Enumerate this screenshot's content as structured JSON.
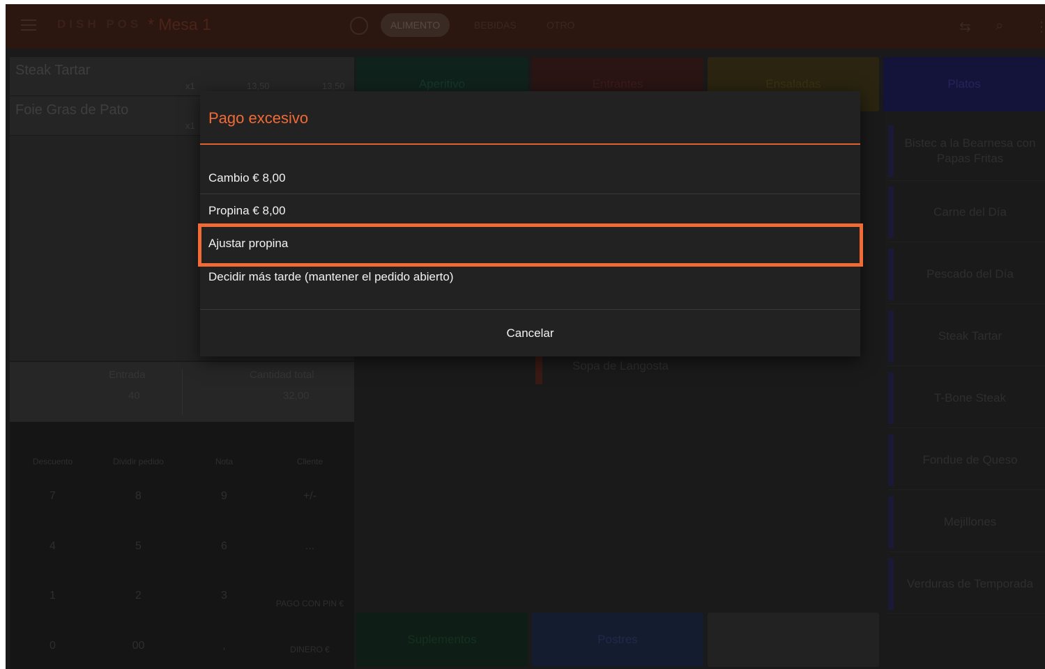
{
  "topbar": {
    "brand": "DISH POS",
    "table": "* Mesa 1",
    "tabs": [
      {
        "label": "ALIMENTO",
        "active": true
      },
      {
        "label": "BEBIDAS",
        "active": false
      },
      {
        "label": "OTRO",
        "active": false
      }
    ]
  },
  "order": {
    "items": [
      {
        "name": "Steak Tartar",
        "qty": "x1",
        "price": "13,50",
        "total": "13,50"
      },
      {
        "name": "Foie Gras de Pato",
        "qty": "x1",
        "price": "",
        "total": ""
      }
    ],
    "entrada_label": "Entrada",
    "entrada_value": "40",
    "cantidad_label": "Cantidad total",
    "cantidad_value": "32,00"
  },
  "keypad": {
    "actions": [
      "Descuento",
      "Dividir pedido",
      "Nota",
      "Cliente"
    ],
    "keys": [
      "7",
      "8",
      "9",
      "+/-",
      "4",
      "5",
      "6",
      "...",
      "1",
      "2",
      "3",
      "0",
      "00",
      ","
    ],
    "pago_pin": "PAGO CON PIN €",
    "dinero": "DINERO €"
  },
  "categories": {
    "aperitivo": "Aperitivo",
    "entrantes": "Entrantes",
    "ensaladas": "Ensaladas",
    "platos": "Platos",
    "suplementos": "Suplementos",
    "postres": "Postres"
  },
  "products": [
    "Bistec a la Bearnesa con Papas Fritas",
    "Carne del Día",
    "Pescado del Día",
    "Steak Tartar",
    "T-Bone Steak",
    "Fondue de Queso",
    "Mejillones",
    "Verduras de Temporada"
  ],
  "middle_products": {
    "sopa": "Sopa de Langosta"
  },
  "dialog": {
    "title": "Pago excesivo",
    "options": [
      "Cambio € 8,00",
      "Propina € 8,00",
      "Ajustar propina",
      "Decidir más tarde (mantener el pedido abierto)"
    ],
    "cancel": "Cancelar"
  },
  "colors": {
    "accent": "#f26a35",
    "dialog_bg": "#222222"
  }
}
